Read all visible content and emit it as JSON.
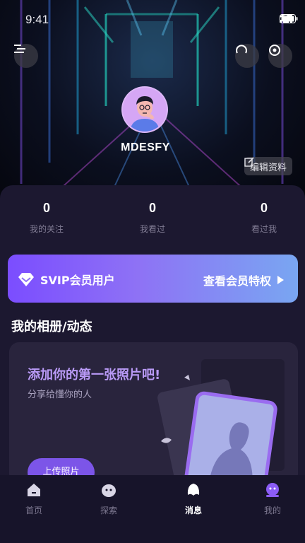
{
  "status_bar": {
    "time": "9:41"
  },
  "profile": {
    "username": "MDESFY",
    "edit_label": "编辑资料"
  },
  "stats": [
    {
      "value": "0",
      "label": "我的关注"
    },
    {
      "value": "0",
      "label": "我看过"
    },
    {
      "value": "0",
      "label": "看过我"
    }
  ],
  "svip": {
    "label": "SVIP会员用户",
    "action": "查看会员特权"
  },
  "album": {
    "section_title": "我的相册/动态",
    "title": "添加你的第一张照片吧!",
    "subtitle": "分享给懂你的人",
    "upload_label": "上传照片"
  },
  "tabbar": {
    "items": [
      {
        "label": "首页"
      },
      {
        "label": "探索"
      },
      {
        "label": "消息"
      },
      {
        "label": "我的"
      }
    ],
    "active_index": 2
  },
  "colors": {
    "accent": "#7c55e8",
    "panel": "#1c1830",
    "card": "#29243d"
  }
}
